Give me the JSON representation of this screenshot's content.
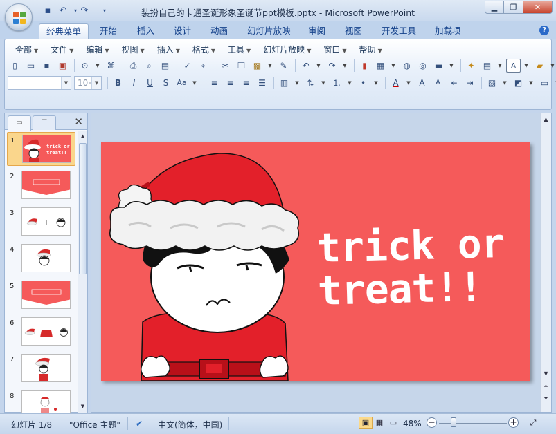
{
  "window": {
    "title": "装扮自己的卡通圣诞形象圣诞节ppt模板.pptx - Microsoft PowerPoint",
    "minimize_icon": "minimize-icon",
    "restore_icon": "restore-icon",
    "close_icon": "close-icon"
  },
  "ribbon_tabs": [
    {
      "label": "经典菜单",
      "active": true
    },
    {
      "label": "开始"
    },
    {
      "label": "插入"
    },
    {
      "label": "设计"
    },
    {
      "label": "动画"
    },
    {
      "label": "幻灯片放映"
    },
    {
      "label": "审阅"
    },
    {
      "label": "视图"
    },
    {
      "label": "开发工具"
    },
    {
      "label": "加载项"
    }
  ],
  "menu": [
    {
      "label": "全部"
    },
    {
      "label": "文件"
    },
    {
      "label": "编辑"
    },
    {
      "label": "视图"
    },
    {
      "label": "插入"
    },
    {
      "label": "格式"
    },
    {
      "label": "工具"
    },
    {
      "label": "幻灯片放映"
    },
    {
      "label": "窗口"
    },
    {
      "label": "帮助"
    }
  ],
  "formatting": {
    "font_size_value": "10+"
  },
  "slides_panel": {
    "slides": [
      {
        "number": "1",
        "selected": true
      },
      {
        "number": "2"
      },
      {
        "number": "3"
      },
      {
        "number": "4"
      },
      {
        "number": "5"
      },
      {
        "number": "6"
      },
      {
        "number": "7"
      },
      {
        "number": "8"
      }
    ]
  },
  "slide": {
    "text_line1": "trick or",
    "text_line2": "treat!!",
    "background_color": "#f55a5a"
  },
  "status": {
    "slide_indicator": "幻灯片 1/8",
    "theme": "\"Office 主题\"",
    "language": "中文(简体，中国)",
    "zoom": "48%"
  },
  "colors": {
    "accent": "#15428b",
    "ribbon_bg": "#dae6f5"
  }
}
